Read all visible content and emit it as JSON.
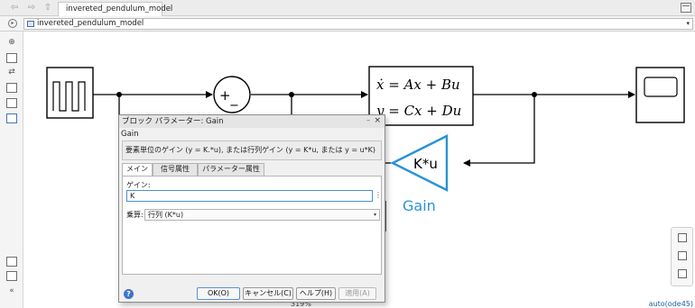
{
  "toolbar": {
    "back_icon": "back-arrow-icon",
    "forward_icon": "forward-arrow-icon",
    "up_icon": "up-arrow-icon",
    "tab_label": "invereted_pendulum_model"
  },
  "address_bar": {
    "model_path": "invereted_pendulum_model",
    "arrow": "▾"
  },
  "left_tools": [
    "zoom-icon",
    "fit-view-icon",
    "arrows-icon",
    "image-icon",
    "annotation-icon",
    "box-icon",
    "camera-icon",
    "model-browser-icon",
    "collapse-icon"
  ],
  "canvas": {
    "sum_plus": "+",
    "sum_minus": "−",
    "state_space_line1": "ẋ = Ax + Bu",
    "state_space_line2": "y = Cx + Du",
    "gain_block_text": "K*u",
    "gain_block_name": "Gain",
    "colors": {
      "gain_blue": "#2a93d5",
      "line": "#000000"
    }
  },
  "dialog": {
    "title": "ブロック パラメーター: Gain",
    "minimize": "–",
    "close": "×",
    "block_name": "Gain",
    "description": "要素単位のゲイン (y = K.*u), または行列ゲイン (y = K*u, または y = u*K)",
    "tabs": [
      "メイン",
      "信号属性",
      "パラメーター属性"
    ],
    "gain_label": "ゲイン:",
    "gain_value": "K",
    "gain_more": "⋮",
    "multiplication_label": "乗算:",
    "multiplication_value": "行列 (K*u)",
    "multiplication_arrow": "▾",
    "help_icon_text": "?",
    "buttons": {
      "ok": "OK(O)",
      "cancel": "キャンセル(C)",
      "help": "ヘルプ(H)",
      "apply": "適用(A)"
    }
  },
  "status": {
    "zoom": "319%",
    "solver": "auto(ode45)"
  }
}
